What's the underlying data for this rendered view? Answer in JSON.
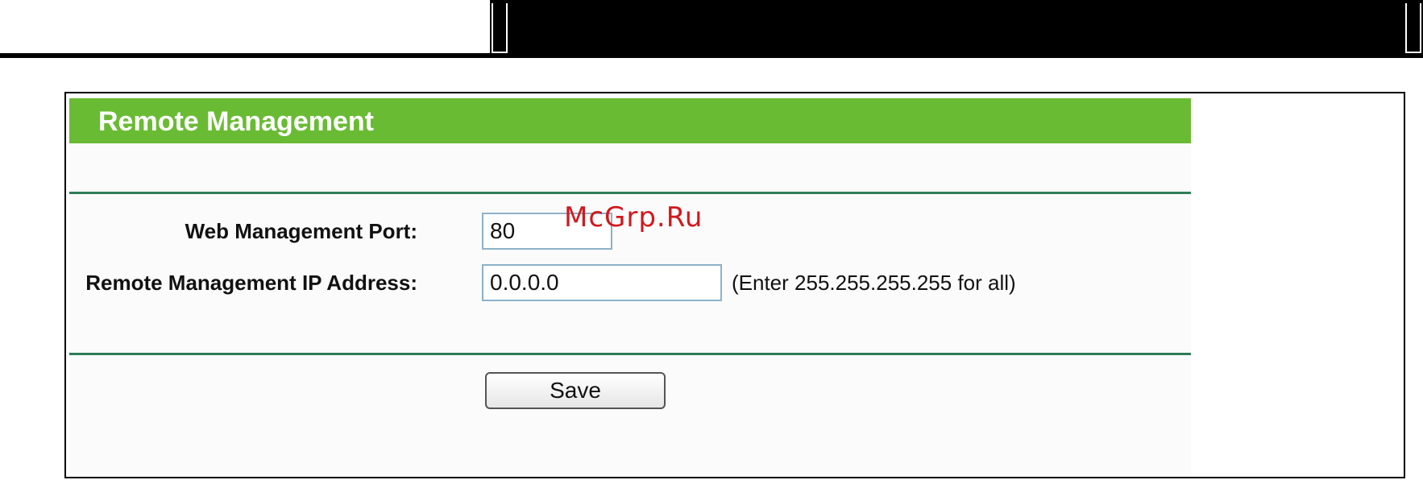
{
  "panel": {
    "title": "Remote Management"
  },
  "form": {
    "port_label": "Web Management Port:",
    "port_value": "80",
    "ip_label": "Remote Management IP Address:",
    "ip_value": "0.0.0.0",
    "ip_hint": "(Enter 255.255.255.255 for all)"
  },
  "actions": {
    "save_label": "Save"
  },
  "watermark": {
    "text": "McGrp.Ru"
  },
  "colors": {
    "title_bar": "#6abb34",
    "divider": "#2f7d58",
    "input_border": "#8db1c9",
    "watermark": "#d2181c"
  }
}
